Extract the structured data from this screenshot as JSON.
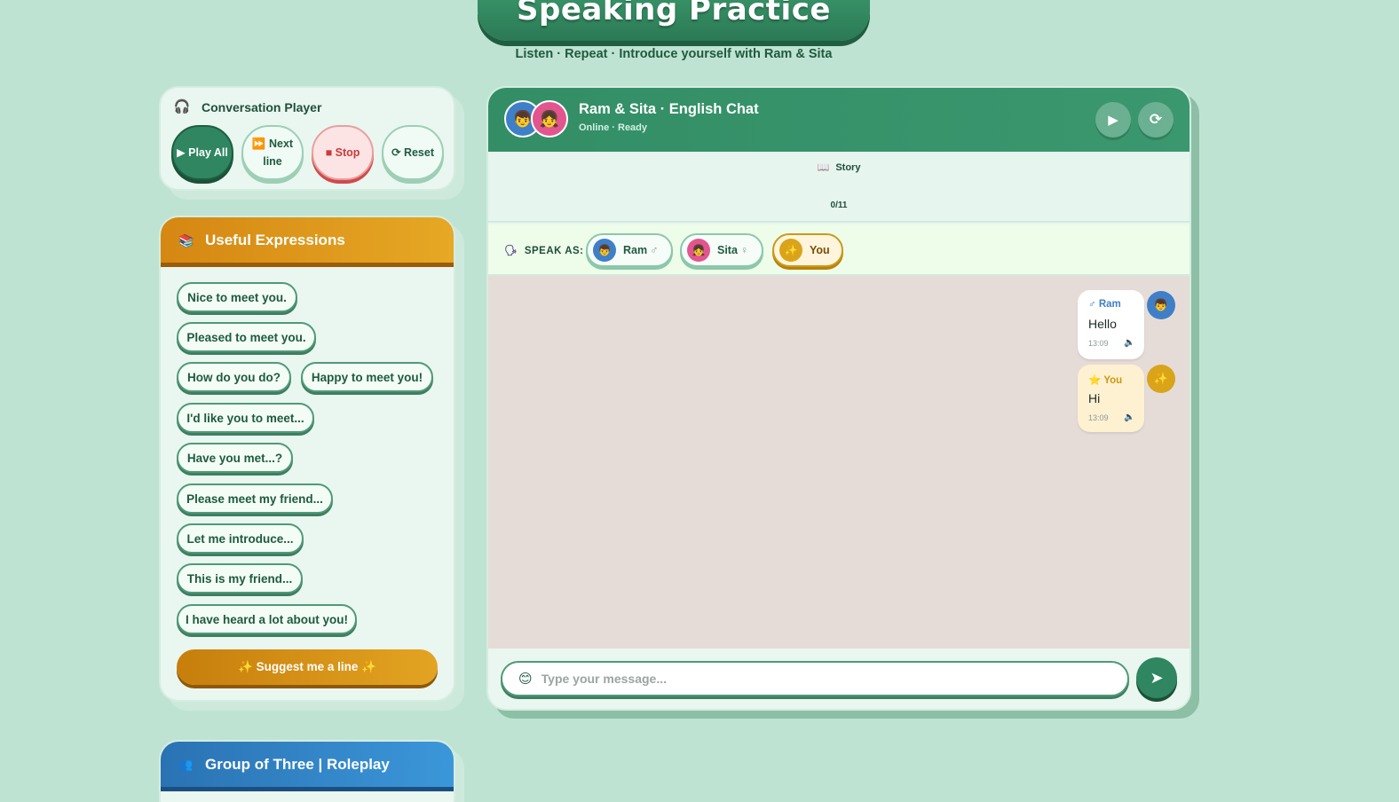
{
  "header": {
    "title": "Speaking Practice",
    "subtitle": "Listen · Repeat · Introduce yourself with Ram & Sita"
  },
  "player": {
    "icon": "headphones-icon",
    "title": "Conversation Player",
    "buttons": {
      "play_all": "▶ Play All",
      "next_line": "⏩ Next line",
      "stop": "■ Stop",
      "reset": "⟳ Reset"
    }
  },
  "expressions": {
    "icon": "books-icon",
    "title": "Useful Expressions",
    "items": [
      "Nice to meet you.",
      "Pleased to meet you.",
      "How do you do?",
      "Happy to meet you!",
      "I'd like you to meet...",
      "Have you met...?",
      "Please meet my friend...",
      "Let me introduce...",
      "This is my friend...",
      "I have heard a lot about you!"
    ],
    "suggest_label": "✨ Suggest me a line ✨"
  },
  "group": {
    "icon": "people-icon",
    "title": "Group of Three | Roleplay"
  },
  "chat": {
    "title": "Ram & Sita · English Chat",
    "status": "Online · Ready",
    "story_label": "Story",
    "story_count": "0/11",
    "speak_as_label": "SPEAK AS:",
    "roles": [
      {
        "name": "Ram",
        "symbol": "♂"
      },
      {
        "name": "Sita",
        "symbol": "♀"
      },
      {
        "name": "You",
        "symbol": ""
      }
    ],
    "messages": [
      {
        "sender": "Ram",
        "sender_symbol": "♂",
        "text": "Hello",
        "time": "13:09",
        "color": "#3e7fc8"
      },
      {
        "sender": "You",
        "sender_symbol": "⭐",
        "text": "Hi",
        "time": "13:09",
        "color": "#d9a41a"
      }
    ],
    "input_placeholder": "Type your message..."
  },
  "colors": {
    "background": "#bfe3d2",
    "primary_green": "#2f8660",
    "expressions_orange": "#e0a020",
    "group_blue": "#2a72b3",
    "ram_blue": "#3e7fc8",
    "sita_pink": "#e2558f",
    "you_gold": "#d9a41a"
  }
}
